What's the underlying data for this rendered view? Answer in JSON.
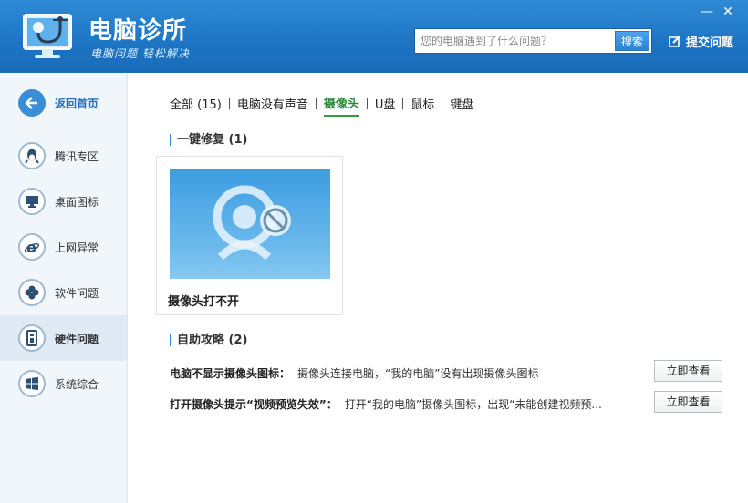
{
  "header": {
    "title": "电脑诊所",
    "slogan": "电脑问题 轻松解决",
    "search_placeholder": "您的电脑遇到了什么问题？",
    "search_button": "搜索",
    "submit_label": "提交问题",
    "minimize": "—",
    "close": "✕"
  },
  "sidebar": {
    "items": [
      {
        "label": "返回首页",
        "icon": "back-arrow-icon"
      },
      {
        "label": "腾讯专区",
        "icon": "qq-penguin-icon"
      },
      {
        "label": "桌面图标",
        "icon": "monitor-icon"
      },
      {
        "label": "上网异常",
        "icon": "ie-browser-icon"
      },
      {
        "label": "软件问题",
        "icon": "clover-icon"
      },
      {
        "label": "硬件问题",
        "icon": "hardware-icon"
      },
      {
        "label": "系统综合",
        "icon": "windows-logo-icon"
      }
    ]
  },
  "tabs": [
    {
      "label": "全部 (15)"
    },
    {
      "label": "电脑没有声音"
    },
    {
      "label": "摄像头"
    },
    {
      "label": "U盘"
    },
    {
      "label": "鼠标"
    },
    {
      "label": "键盘"
    }
  ],
  "oneclick": {
    "title": "一键修复 (1)",
    "card_title": "摄像头打不开"
  },
  "guides": {
    "title": "自助攻略 (2)",
    "rows": [
      {
        "title": "电脑不显示摄像头图标：",
        "desc": "摄像头连接电脑，“我的电脑”没有出现摄像头图标",
        "button": "立即查看"
      },
      {
        "title": "打开摄像头提示“视频预览失效”：",
        "desc": "打开“我的电脑”摄像头图标，出现“未能创建视频预...",
        "button": "立即查看"
      }
    ]
  },
  "colors": {
    "header_blue": "#1d74c4",
    "active_tab_green": "#3a9a44",
    "sidebar_bg": "#f1f6fb"
  }
}
